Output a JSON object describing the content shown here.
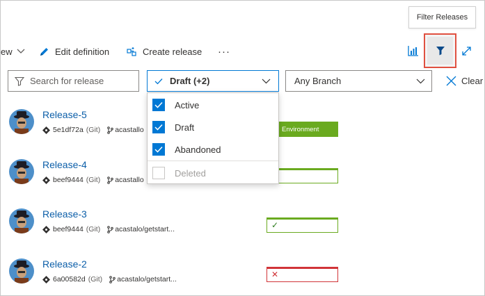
{
  "tooltip": {
    "text": "Filter Releases"
  },
  "toolbar": {
    "view_fragment": "ew",
    "edit_label": "Edit definition",
    "create_label": "Create release",
    "more_label": "···"
  },
  "filters": {
    "search_placeholder": "Search for release",
    "status_value": "Draft (+2)",
    "branch_value": "Any Branch",
    "clear_label": "Clear"
  },
  "status_options": [
    {
      "label": "Active",
      "checked": true
    },
    {
      "label": "Draft",
      "checked": true
    },
    {
      "label": "Abandoned",
      "checked": true
    },
    {
      "label": "Deleted",
      "checked": false
    }
  ],
  "releases": [
    {
      "name": "Release-5",
      "commit": "5e1df72a",
      "repo_type": "(Git)",
      "branch": "acastallo",
      "env_label": "Environment",
      "env_state": "filled"
    },
    {
      "name": "Release-4",
      "commit": "beef9444",
      "repo_type": "(Git)",
      "branch": "acastallo",
      "env_label": "",
      "env_state": "ok-empty"
    },
    {
      "name": "Release-3",
      "commit": "beef9444",
      "repo_type": "(Git)",
      "branch": "acastalo/getstart...",
      "env_label": "",
      "env_state": "succeeded"
    },
    {
      "name": "Release-2",
      "commit": "6a00582d",
      "repo_type": "(Git)",
      "branch": "acastalo/getstart...",
      "env_label": "",
      "env_state": "failed"
    }
  ],
  "colors": {
    "accent": "#0078d4",
    "success": "#6aaa1f",
    "failure": "#d13438",
    "highlight": "#e05040"
  }
}
